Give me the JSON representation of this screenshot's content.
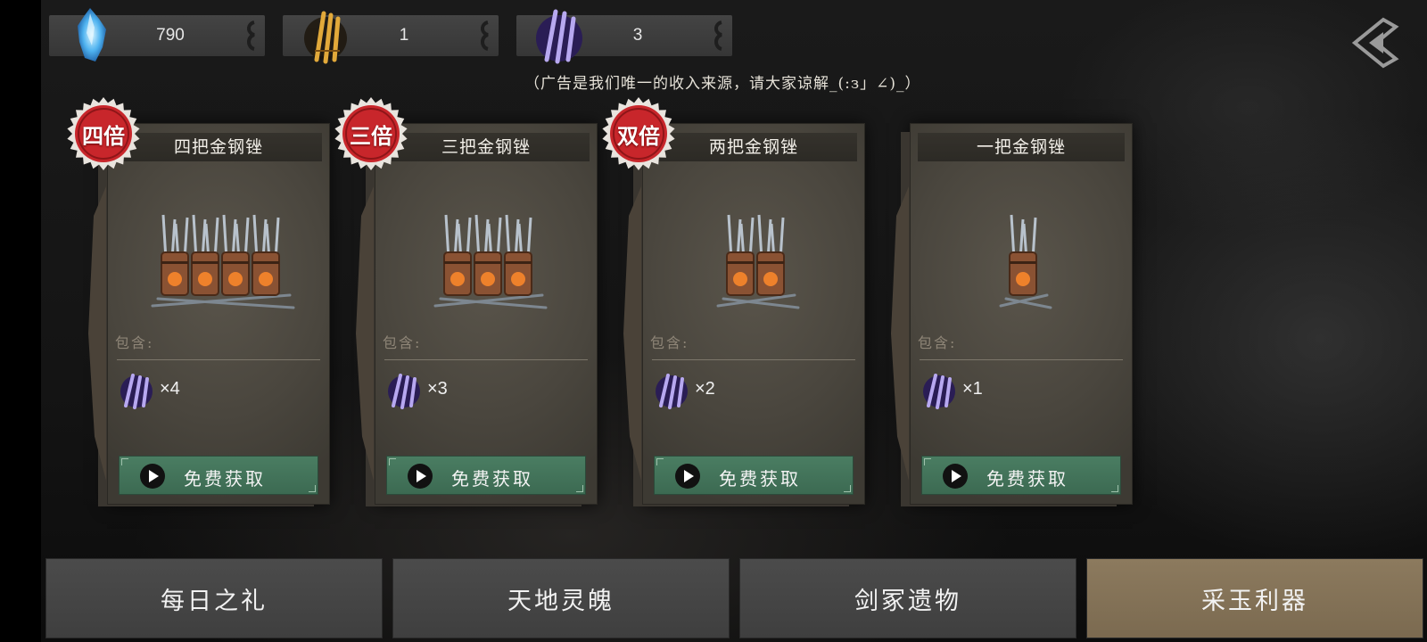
{
  "currencies": [
    {
      "icon": "blue-crystal-icon",
      "value": "790"
    },
    {
      "icon": "gold-chisel-icon",
      "value": "1"
    },
    {
      "icon": "purple-steel-file-icon",
      "value": "3"
    }
  ],
  "ad_note": "（广告是我们唯一的收入来源，请大家谅解_(:з」∠)_）",
  "cards": [
    {
      "badge": "四倍",
      "title": "四把金钢锉",
      "contains_label": "包含:",
      "item_icon": "purple-steel-file-icon",
      "qty": "×4",
      "button": "免费获取",
      "bucket_count": 4
    },
    {
      "badge": "三倍",
      "title": "三把金钢锉",
      "contains_label": "包含:",
      "item_icon": "purple-steel-file-icon",
      "qty": "×3",
      "button": "免费获取",
      "bucket_count": 3
    },
    {
      "badge": "双倍",
      "title": "两把金钢锉",
      "contains_label": "包含:",
      "item_icon": "purple-steel-file-icon",
      "qty": "×2",
      "button": "免费获取",
      "bucket_count": 2
    },
    {
      "badge": "",
      "title": "一把金钢锉",
      "contains_label": "包含:",
      "item_icon": "purple-steel-file-icon",
      "qty": "×1",
      "button": "免费获取",
      "bucket_count": 1
    }
  ],
  "tabs": [
    {
      "label": "每日之礼",
      "active": false
    },
    {
      "label": "天地灵魄",
      "active": false
    },
    {
      "label": "剑冢遗物",
      "active": false
    },
    {
      "label": "采玉利器",
      "active": true
    }
  ],
  "colors": {
    "button_green": "#4a7d62",
    "badge_red": "#c8262b",
    "active_tab": "#8c7a5e",
    "item_purple": "#6a4fc8"
  }
}
